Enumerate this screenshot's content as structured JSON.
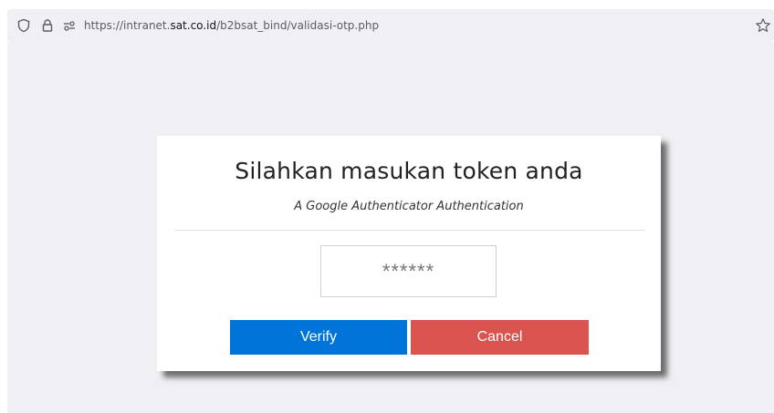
{
  "browser": {
    "url_prefix": "https://intranet.",
    "url_host": "sat.co.id",
    "url_path": "/b2bsat_bind/validasi-otp.php",
    "icons": [
      "shield-icon",
      "lock-icon",
      "permissions-icon",
      "star-icon"
    ]
  },
  "card": {
    "title": "Silahkan masukan token anda",
    "subtitle": "A Google Authenticator Authentication"
  },
  "token": {
    "placeholder": "******"
  },
  "buttons": {
    "verify": "Verify",
    "cancel": "Cancel"
  },
  "colors": {
    "verify": "#0074d9",
    "cancel": "#d9534f",
    "page_bg": "#f0f0f4"
  }
}
